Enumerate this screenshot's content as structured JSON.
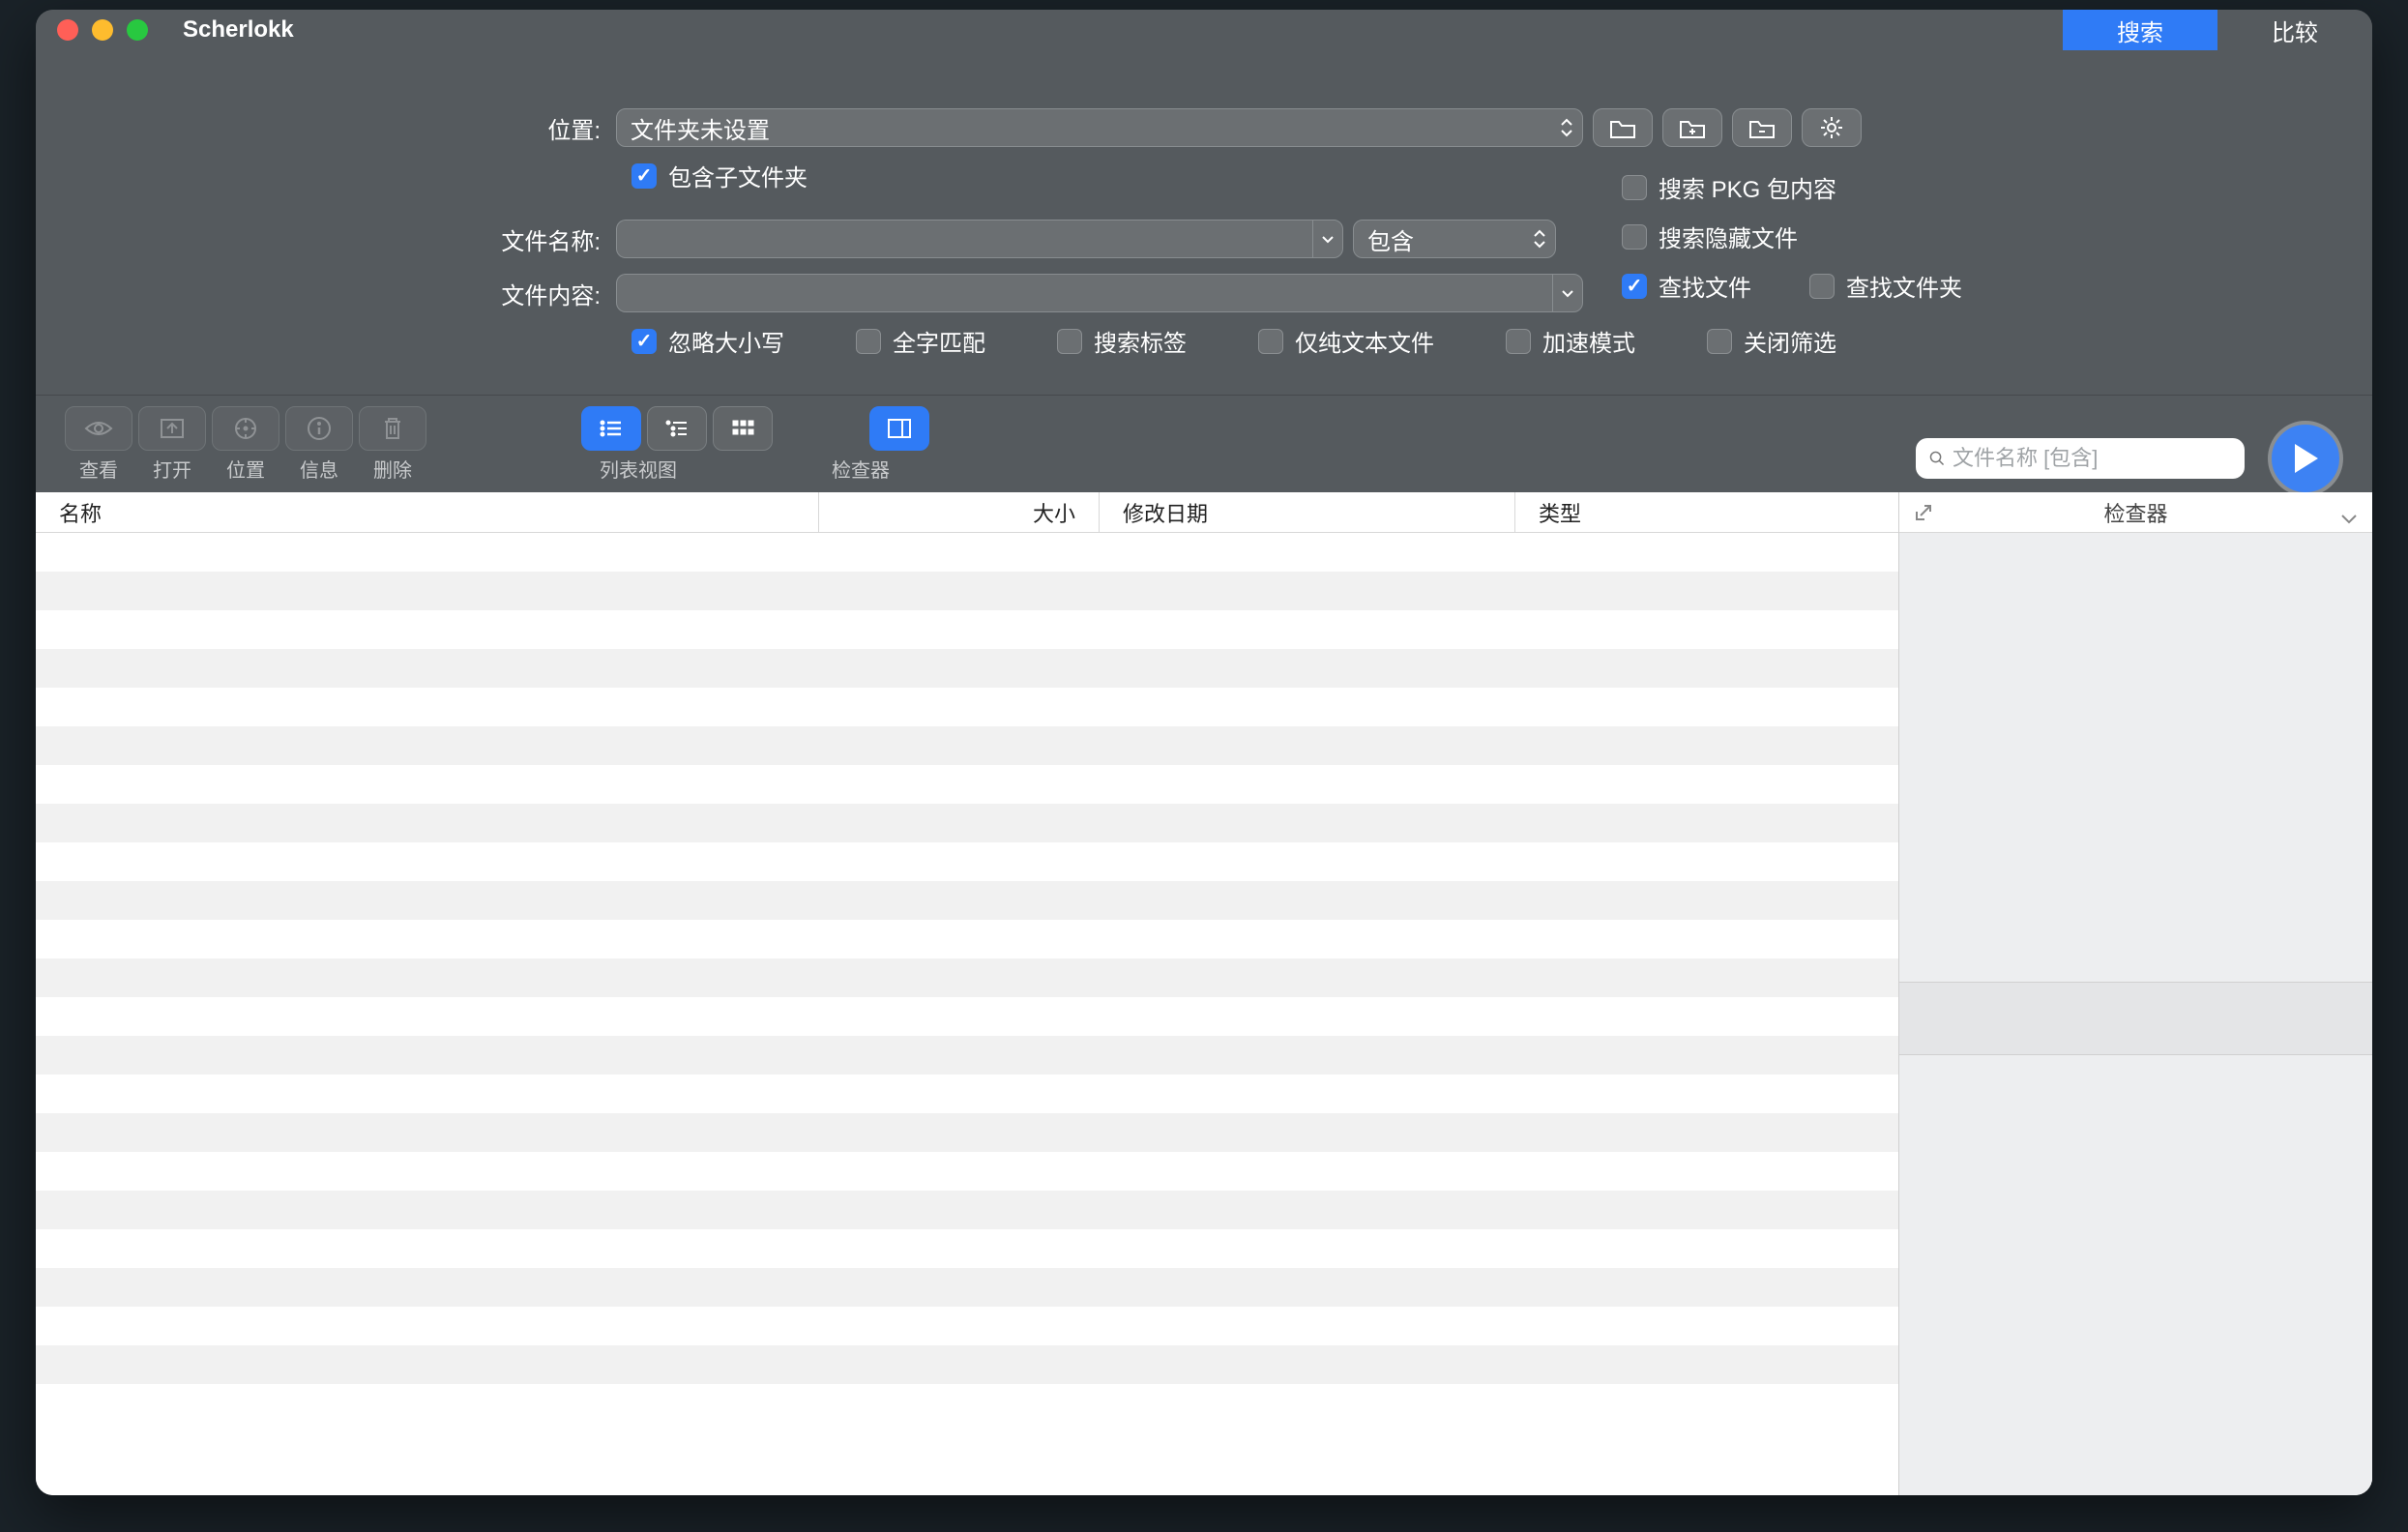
{
  "titlebar": {
    "app_name": "Scherlokk",
    "tabs": {
      "search": "搜索",
      "compare": "比较"
    }
  },
  "form": {
    "location_label": "位置:",
    "location_value": "文件夹未设置",
    "include_subfolders": "包含子文件夹",
    "filename_label": "文件名称:",
    "match_mode": "包含",
    "content_label": "文件内容:",
    "ignore_case": "忽略大小写",
    "whole_word": "全字匹配",
    "search_tags": "搜索标签",
    "plain_text_only": "仅纯文本文件",
    "search_pkg": "搜索 PKG 包内容",
    "search_hidden": "搜索隐藏文件",
    "find_files": "查找文件",
    "find_folders": "查找文件夹",
    "accel_mode": "加速模式",
    "close_filter": "关闭筛选"
  },
  "toolbar": {
    "view": "查看",
    "open": "打开",
    "reveal": "位置",
    "info": "信息",
    "delete": "删除",
    "list_view_group": "列表视图",
    "inspector_group": "检查器",
    "search_placeholder": "文件名称 [包含]"
  },
  "columns": {
    "name": "名称",
    "size": "大小",
    "date": "修改日期",
    "type": "类型"
  },
  "inspector": {
    "title": "检查器"
  }
}
